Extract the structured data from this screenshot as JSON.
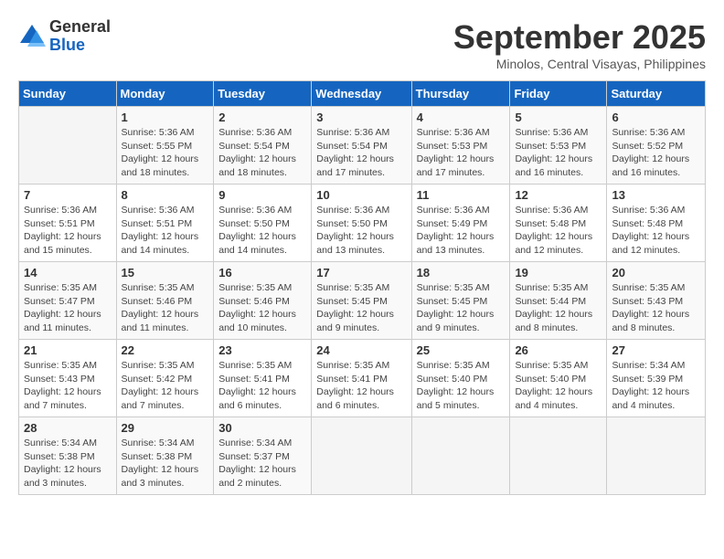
{
  "logo": {
    "general": "General",
    "blue": "Blue"
  },
  "title": "September 2025",
  "subtitle": "Minolos, Central Visayas, Philippines",
  "days_of_week": [
    "Sunday",
    "Monday",
    "Tuesday",
    "Wednesday",
    "Thursday",
    "Friday",
    "Saturday"
  ],
  "weeks": [
    [
      {
        "day": "",
        "detail": ""
      },
      {
        "day": "1",
        "detail": "Sunrise: 5:36 AM\nSunset: 5:55 PM\nDaylight: 12 hours\nand 18 minutes."
      },
      {
        "day": "2",
        "detail": "Sunrise: 5:36 AM\nSunset: 5:54 PM\nDaylight: 12 hours\nand 18 minutes."
      },
      {
        "day": "3",
        "detail": "Sunrise: 5:36 AM\nSunset: 5:54 PM\nDaylight: 12 hours\nand 17 minutes."
      },
      {
        "day": "4",
        "detail": "Sunrise: 5:36 AM\nSunset: 5:53 PM\nDaylight: 12 hours\nand 17 minutes."
      },
      {
        "day": "5",
        "detail": "Sunrise: 5:36 AM\nSunset: 5:53 PM\nDaylight: 12 hours\nand 16 minutes."
      },
      {
        "day": "6",
        "detail": "Sunrise: 5:36 AM\nSunset: 5:52 PM\nDaylight: 12 hours\nand 16 minutes."
      }
    ],
    [
      {
        "day": "7",
        "detail": "Sunrise: 5:36 AM\nSunset: 5:51 PM\nDaylight: 12 hours\nand 15 minutes."
      },
      {
        "day": "8",
        "detail": "Sunrise: 5:36 AM\nSunset: 5:51 PM\nDaylight: 12 hours\nand 14 minutes."
      },
      {
        "day": "9",
        "detail": "Sunrise: 5:36 AM\nSunset: 5:50 PM\nDaylight: 12 hours\nand 14 minutes."
      },
      {
        "day": "10",
        "detail": "Sunrise: 5:36 AM\nSunset: 5:50 PM\nDaylight: 12 hours\nand 13 minutes."
      },
      {
        "day": "11",
        "detail": "Sunrise: 5:36 AM\nSunset: 5:49 PM\nDaylight: 12 hours\nand 13 minutes."
      },
      {
        "day": "12",
        "detail": "Sunrise: 5:36 AM\nSunset: 5:48 PM\nDaylight: 12 hours\nand 12 minutes."
      },
      {
        "day": "13",
        "detail": "Sunrise: 5:36 AM\nSunset: 5:48 PM\nDaylight: 12 hours\nand 12 minutes."
      }
    ],
    [
      {
        "day": "14",
        "detail": "Sunrise: 5:35 AM\nSunset: 5:47 PM\nDaylight: 12 hours\nand 11 minutes."
      },
      {
        "day": "15",
        "detail": "Sunrise: 5:35 AM\nSunset: 5:46 PM\nDaylight: 12 hours\nand 11 minutes."
      },
      {
        "day": "16",
        "detail": "Sunrise: 5:35 AM\nSunset: 5:46 PM\nDaylight: 12 hours\nand 10 minutes."
      },
      {
        "day": "17",
        "detail": "Sunrise: 5:35 AM\nSunset: 5:45 PM\nDaylight: 12 hours\nand 9 minutes."
      },
      {
        "day": "18",
        "detail": "Sunrise: 5:35 AM\nSunset: 5:45 PM\nDaylight: 12 hours\nand 9 minutes."
      },
      {
        "day": "19",
        "detail": "Sunrise: 5:35 AM\nSunset: 5:44 PM\nDaylight: 12 hours\nand 8 minutes."
      },
      {
        "day": "20",
        "detail": "Sunrise: 5:35 AM\nSunset: 5:43 PM\nDaylight: 12 hours\nand 8 minutes."
      }
    ],
    [
      {
        "day": "21",
        "detail": "Sunrise: 5:35 AM\nSunset: 5:43 PM\nDaylight: 12 hours\nand 7 minutes."
      },
      {
        "day": "22",
        "detail": "Sunrise: 5:35 AM\nSunset: 5:42 PM\nDaylight: 12 hours\nand 7 minutes."
      },
      {
        "day": "23",
        "detail": "Sunrise: 5:35 AM\nSunset: 5:41 PM\nDaylight: 12 hours\nand 6 minutes."
      },
      {
        "day": "24",
        "detail": "Sunrise: 5:35 AM\nSunset: 5:41 PM\nDaylight: 12 hours\nand 6 minutes."
      },
      {
        "day": "25",
        "detail": "Sunrise: 5:35 AM\nSunset: 5:40 PM\nDaylight: 12 hours\nand 5 minutes."
      },
      {
        "day": "26",
        "detail": "Sunrise: 5:35 AM\nSunset: 5:40 PM\nDaylight: 12 hours\nand 4 minutes."
      },
      {
        "day": "27",
        "detail": "Sunrise: 5:34 AM\nSunset: 5:39 PM\nDaylight: 12 hours\nand 4 minutes."
      }
    ],
    [
      {
        "day": "28",
        "detail": "Sunrise: 5:34 AM\nSunset: 5:38 PM\nDaylight: 12 hours\nand 3 minutes."
      },
      {
        "day": "29",
        "detail": "Sunrise: 5:34 AM\nSunset: 5:38 PM\nDaylight: 12 hours\nand 3 minutes."
      },
      {
        "day": "30",
        "detail": "Sunrise: 5:34 AM\nSunset: 5:37 PM\nDaylight: 12 hours\nand 2 minutes."
      },
      {
        "day": "",
        "detail": ""
      },
      {
        "day": "",
        "detail": ""
      },
      {
        "day": "",
        "detail": ""
      },
      {
        "day": "",
        "detail": ""
      }
    ]
  ]
}
